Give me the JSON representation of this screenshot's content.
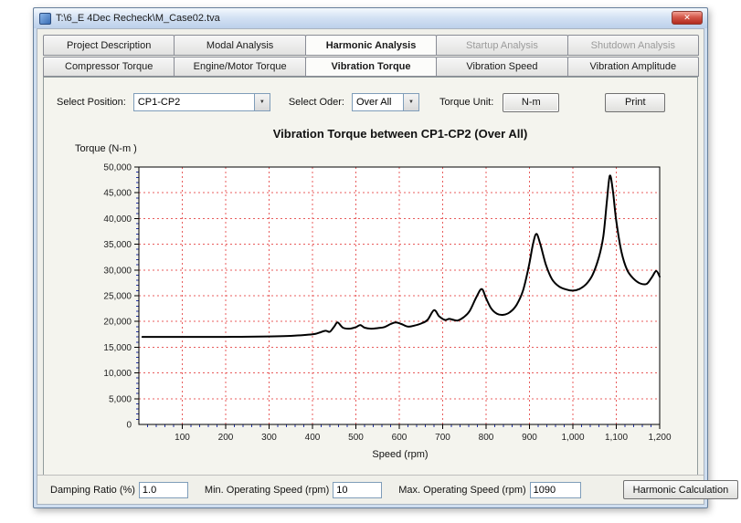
{
  "window": {
    "title": "T:\\6_E 4Dec Recheck\\M_Case02.tva"
  },
  "icons": {
    "close": "✕",
    "dropdown": "▼"
  },
  "main_tabs": [
    {
      "label": "Project Description",
      "name": "tab-project-description",
      "state": "normal"
    },
    {
      "label": "Modal Analysis",
      "name": "tab-modal-analysis",
      "state": "normal"
    },
    {
      "label": "Harmonic Analysis",
      "name": "tab-harmonic-analysis",
      "state": "selected"
    },
    {
      "label": "Startup Analysis",
      "name": "tab-startup-analysis",
      "state": "disabled"
    },
    {
      "label": "Shutdown Analysis",
      "name": "tab-shutdown-analysis",
      "state": "disabled"
    }
  ],
  "sub_tabs": [
    {
      "label": "Compressor Torque",
      "name": "tab-compressor-torque",
      "state": "normal"
    },
    {
      "label": "Engine/Motor Torque",
      "name": "tab-engine-motor-torque",
      "state": "normal"
    },
    {
      "label": "Vibration Torque",
      "name": "tab-vibration-torque",
      "state": "selected"
    },
    {
      "label": "Vibration Speed",
      "name": "tab-vibration-speed",
      "state": "normal"
    },
    {
      "label": "Vibration Amplitude",
      "name": "tab-vibration-amplitude",
      "state": "normal"
    }
  ],
  "controls": {
    "select_position_label": "Select Position:",
    "select_position_value": "CP1-CP2",
    "select_order_label": "Select Oder:",
    "select_order_value": "Over All",
    "torque_unit_label": "Torque Unit:",
    "torque_unit_value": "N-m",
    "print_label": "Print"
  },
  "chart_data": {
    "type": "line",
    "title": "Vibration Torque between CP1-CP2 (Over All)",
    "ylabel": "Torque (N-m )",
    "xlabel": "Speed (rpm)",
    "xlim": [
      0,
      1200
    ],
    "ylim": [
      0,
      50000
    ],
    "x_ticks": [
      100,
      200,
      300,
      400,
      500,
      600,
      700,
      800,
      900,
      1000,
      1100,
      1200
    ],
    "y_ticks": [
      0,
      5000,
      10000,
      15000,
      20000,
      25000,
      30000,
      35000,
      40000,
      45000,
      50000
    ],
    "x_minor": 20,
    "y_minor": 1000,
    "grid": true,
    "grid_color": "#e85c5c",
    "minor_tick_color": "#2233aa",
    "line_color": "#000000",
    "series": [
      {
        "name": "Vibration Torque",
        "x": [
          8,
          100,
          200,
          300,
          350,
          400,
          415,
          430,
          440,
          450,
          458,
          470,
          485,
          500,
          510,
          520,
          535,
          550,
          565,
          580,
          592,
          605,
          620,
          635,
          650,
          665,
          680,
          692,
          705,
          715,
          725,
          735,
          748,
          762,
          778,
          790,
          800,
          812,
          825,
          840,
          855,
          870,
          885,
          898,
          908,
          916,
          925,
          938,
          952,
          968,
          985,
          1000,
          1015,
          1030,
          1045,
          1060,
          1070,
          1078,
          1085,
          1092,
          1100,
          1112,
          1125,
          1140,
          1155,
          1170,
          1182,
          1192,
          1200
        ],
        "y": [
          17000,
          17000,
          17000,
          17100,
          17200,
          17500,
          17800,
          18200,
          18000,
          19000,
          19800,
          18800,
          18600,
          18900,
          19300,
          18800,
          18600,
          18700,
          18900,
          19500,
          19800,
          19500,
          19000,
          19200,
          19600,
          20300,
          22200,
          21000,
          20300,
          20500,
          20300,
          20200,
          20800,
          22000,
          24800,
          26300,
          24500,
          22500,
          21500,
          21300,
          21800,
          23200,
          26000,
          30500,
          35000,
          37000,
          35000,
          31000,
          28200,
          26800,
          26200,
          26000,
          26300,
          27200,
          29000,
          32500,
          36500,
          43000,
          48300,
          45500,
          39500,
          33500,
          30000,
          28300,
          27400,
          27300,
          28600,
          29800,
          28700
        ]
      }
    ]
  },
  "footer": {
    "damping_label": "Damping Ratio (%)",
    "damping_value": "1.0",
    "min_speed_label": "Min. Operating Speed (rpm)",
    "min_speed_value": "10",
    "max_speed_label": "Max. Operating Speed (rpm)",
    "max_speed_value": "1090",
    "calc_button": "Harmonic Calculation"
  }
}
